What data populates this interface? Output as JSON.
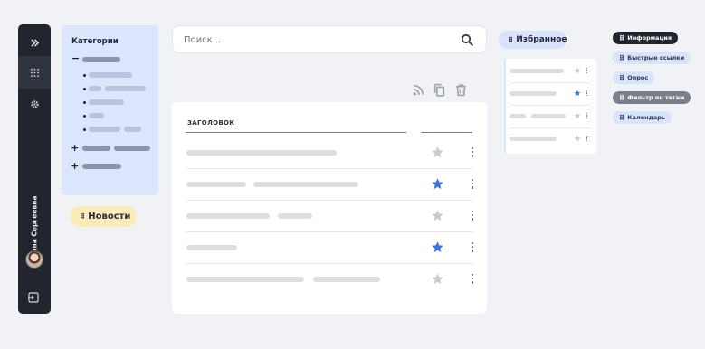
{
  "rail": {
    "user_name": "Анна Сергеевна"
  },
  "categories": {
    "title": "Категории"
  },
  "chips": {
    "news": "Новости",
    "favorites": "Избранное",
    "info": "Информация",
    "quick_links": "Быстрые ссылки",
    "poll": "Опрос",
    "tag_filter": "Фильтр по тегам",
    "calendar": "Календарь"
  },
  "search": {
    "placeholder": "Поиск..."
  },
  "table": {
    "header_title": "ЗАГОЛОВОК",
    "rows": [
      {
        "starred": false
      },
      {
        "starred": true
      },
      {
        "starred": false
      },
      {
        "starred": true
      },
      {
        "starred": false
      }
    ]
  },
  "favorites_widget": {
    "rows": [
      {
        "starred": false
      },
      {
        "starred": true
      },
      {
        "starred": false
      },
      {
        "starred": false
      }
    ]
  },
  "colors": {
    "rail": "#22252d",
    "accent_star": "#3d74d6",
    "star_off": "#c7cad0",
    "categories_bg": "#dbe5fb",
    "news_chip_bg": "#fbebb8"
  }
}
